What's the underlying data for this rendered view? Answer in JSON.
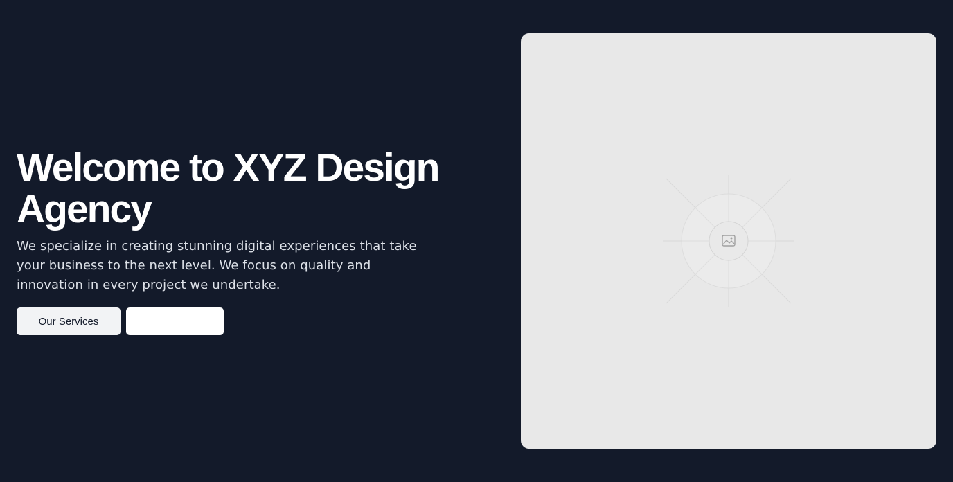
{
  "hero": {
    "title": "Welcome to XYZ Design Agency",
    "description": "We specialize in creating stunning digital experiences that take your business to the next level. We focus on quality and innovation in every project we undertake.",
    "buttons": {
      "services_label": "Our Services",
      "secondary_label": ""
    }
  },
  "image_panel": {
    "icon": "image-placeholder-icon"
  },
  "colors": {
    "background": "#131a2a",
    "panel": "#e8e8e8",
    "button_primary_bg": "#f2f3f5",
    "button_secondary_bg": "#ffffff",
    "title": "#ffffff",
    "description": "#dde1e8"
  }
}
